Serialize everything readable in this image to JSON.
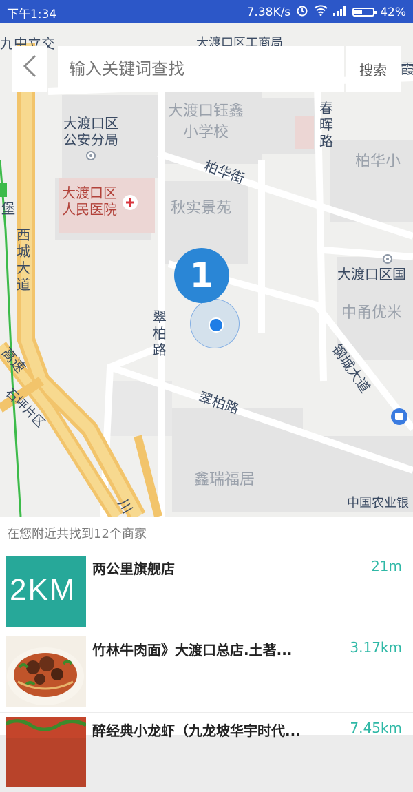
{
  "status_bar": {
    "time": "下午1:34",
    "speed": "7.38K/s",
    "battery": "42%",
    "battery_level": 0.42,
    "icons": [
      "alarm-icon",
      "wifi-icon",
      "signal-icon",
      "battery-icon"
    ]
  },
  "search": {
    "back_icon": "chevron-left-icon",
    "placeholder": "输入关键词查找",
    "button_label": "搜索"
  },
  "map": {
    "labels": {
      "jiuzhong": "九中立交",
      "dadukou_gongshang": "大渡口区工商局",
      "xia": "霞",
      "zhuxin_school_1": "大渡口钰鑫",
      "zhuxin_school_2": "小学校",
      "police_1": "大渡口区",
      "police_2": "公安分局",
      "chunhui": "春晖路",
      "baihua_xiao": "柏华小",
      "baihua_st": "柏华街",
      "hospital_1": "大渡口区",
      "hospital_2": "人民医院",
      "qiushi": "秋实景苑",
      "bao": "堡",
      "xicheng": "西城大道",
      "dadukou_guotu": "大渡口区国",
      "zhongyong": "中甬优米",
      "cuibai_v": "翠柏路",
      "gongnong": "钢城大道",
      "gaosu": "高速",
      "shipaibang": "石坪片区",
      "cuibai_h": "翠柏路",
      "xinrui": "鑫瑞福居",
      "abc": "中国农业银",
      "chuan": "川"
    },
    "marker_number": "1",
    "accent": "#2a86d6"
  },
  "results": {
    "title": "在您附近共找到12个商家",
    "items": [
      {
        "name": "两公里旗舰店",
        "distance": "21m",
        "thumb_text": "2KM"
      },
      {
        "name": "竹林牛肉面》大渡口总店.土著...",
        "distance": "3.17km"
      },
      {
        "name": "醉经典小龙虾（九龙坡华宇时代...",
        "distance": "7.45km"
      }
    ]
  }
}
